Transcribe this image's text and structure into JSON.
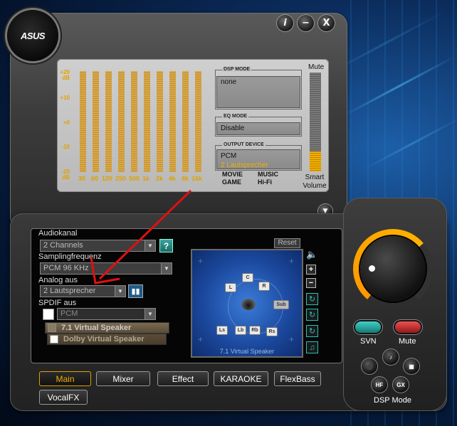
{
  "window": {
    "logo": "ASUS",
    "buttons": {
      "info": "i",
      "minimize": "−",
      "close": "X"
    }
  },
  "equalizer": {
    "db_labels": [
      "+20\ndB",
      "+10",
      "+0",
      "-10",
      "-20\ndB"
    ],
    "frequencies": [
      "30",
      "60",
      "120",
      "250",
      "500",
      "1k",
      "2k",
      "4k",
      "8k",
      "16k"
    ],
    "levels": [
      0.5,
      0.5,
      0.5,
      0.5,
      0.5,
      0.5,
      0.5,
      0.5,
      0.5,
      0.5
    ]
  },
  "display": {
    "dsp_mode_label": "DSP MODE",
    "dsp_mode_value": "none",
    "eq_mode_label": "EQ MODE",
    "eq_mode_value": "Disable",
    "output_device_label": "OUTPUT DEVICE",
    "output_device_line1": "PCM",
    "output_device_line2": "2 Lautsprecher",
    "mode_movie": "MOVIE",
    "mode_game": "GAME",
    "mode_music": "MUSIC",
    "mode_hifi": "Hi-Fi",
    "mute_label": "Mute",
    "smart_volume_label": "Smart\nVolume",
    "volume_level": 0.2
  },
  "settings": {
    "audiokanal_label": "Audiokanal",
    "audiokanal_value": "2 Channels",
    "help_label": "?",
    "samplingfrequenz_label": "Samplingfrequenz",
    "samplingfrequenz_value": "PCM 96 KHz",
    "analog_aus_label": "Analog aus",
    "analog_aus_value": "2 Lautsprecher",
    "spdif_aus_label": "SPDIF aus",
    "spdif_aus_value": "PCM",
    "virtual_speaker_label": "7.1 Virtual Speaker",
    "dolby_label": "Dolby Virtual Speaker"
  },
  "speakers": {
    "reset_label": "Reset",
    "caption": "7.1 Virtual Speaker",
    "sub_label": "Sub",
    "positions": [
      "C",
      "L",
      "R",
      "Ls",
      "Lb",
      "Rb",
      "Rs"
    ]
  },
  "tabs": {
    "main": "Main",
    "mixer": "Mixer",
    "effect": "Effect",
    "karaoke": "KARAOKE",
    "flexbass": "FlexBass",
    "vocalfx": "VocalFX"
  },
  "right_controls": {
    "svn_label": "SVN",
    "mute_label": "Mute",
    "dsp_mode_label": "DSP Mode",
    "hf_label": "HF",
    "gx_label": "GX"
  },
  "colors": {
    "accent": "#f0b000",
    "teal": "#2ac0b8",
    "red": "#d03030"
  }
}
